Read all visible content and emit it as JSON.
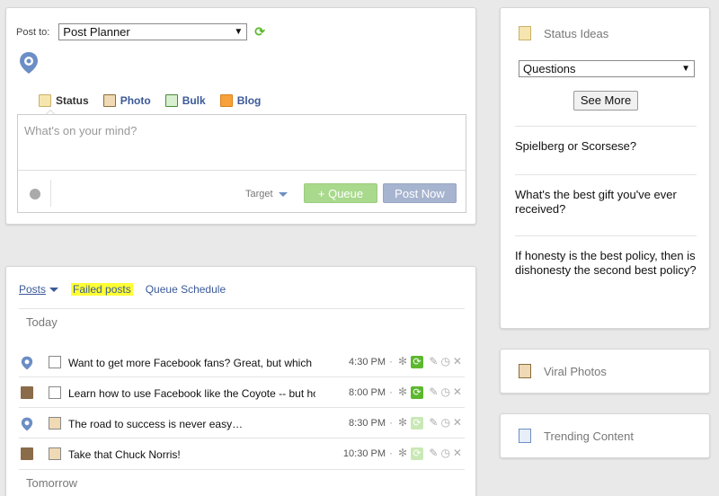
{
  "composer": {
    "post_to_label": "Post to:",
    "post_to_value": "Post Planner",
    "tabs": [
      {
        "label": "Status",
        "icon": "status-note-icon"
      },
      {
        "label": "Photo",
        "icon": "photo-icon"
      },
      {
        "label": "Bulk",
        "icon": "bulk-spreadsheet-icon"
      },
      {
        "label": "Blog",
        "icon": "rss-icon"
      }
    ],
    "placeholder": "What's on your mind?",
    "target_label": "Target",
    "queue_label": "+ Queue",
    "post_now_label": "Post Now"
  },
  "posts": {
    "tabs": {
      "posts": "Posts",
      "failed": "Failed posts",
      "schedule": "Queue Schedule"
    },
    "today_label": "Today",
    "tomorrow_label": "Tomorrow",
    "rows": [
      {
        "text": "Want to get more Facebook fans? Great, but which ki…",
        "time": "4:30 PM",
        "avatar": "post-planner-logo-icon",
        "type": "link-icon"
      },
      {
        "text": "Learn how to use Facebook like the Coyote -- but hop…",
        "time": "8:00 PM",
        "avatar": "user-photo-icon",
        "type": "link-icon"
      },
      {
        "text": "The road to success is never easy…",
        "time": "8:30 PM",
        "avatar": "post-planner-logo-icon",
        "type": "photo-icon"
      },
      {
        "text": "Take that Chuck Norris!",
        "time": "10:30 PM",
        "avatar": "user-photo-icon",
        "type": "photo-icon"
      }
    ]
  },
  "ideas": {
    "title": "Status Ideas",
    "category": "Questions",
    "see_more": "See More",
    "items": [
      "Spielberg or Scorsese?",
      "What's the best gift you've ever received?",
      "If honesty is the best policy, then is dishonesty the second best policy?"
    ]
  },
  "viral": {
    "title": "Viral Photos"
  },
  "trending": {
    "title": "Trending Content"
  },
  "colors": {
    "link": "#3b5998",
    "queue_green": "#a9d98c",
    "post_now_blue": "#a7b4cf",
    "highlight": "#ffff33",
    "refresh_green": "#5cb82e"
  }
}
